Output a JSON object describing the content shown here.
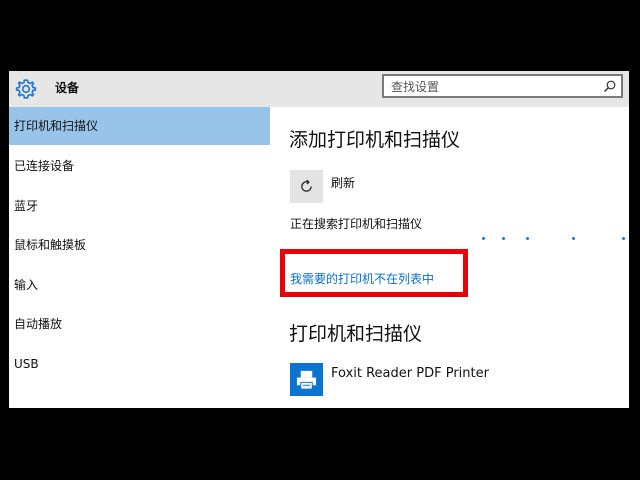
{
  "window": {
    "title": "设备"
  },
  "search": {
    "placeholder": "查找设置"
  },
  "sidebar": {
    "items": [
      {
        "label": "打印机和扫描仪",
        "active": true
      },
      {
        "label": "已连接设备"
      },
      {
        "label": "蓝牙"
      },
      {
        "label": "鼠标和触摸板"
      },
      {
        "label": "输入"
      },
      {
        "label": "自动播放"
      },
      {
        "label": "USB"
      }
    ]
  },
  "main": {
    "add_heading": "添加打印机和扫描仪",
    "refresh_label": "刷新",
    "searching_text": "正在搜索打印机和扫描仪",
    "not_listed_link": "我需要的打印机不在列表中",
    "printers_heading": "打印机和扫描仪",
    "printers": [
      {
        "name": "Foxit Reader PDF Printer"
      }
    ]
  },
  "colors": {
    "accent": "#0a6fc9",
    "active_item_bg": "#99c4e9",
    "highlight_border": "#e8000b",
    "printer_icon_bg": "#0a74d0"
  },
  "icons": {
    "settings": "gear-icon",
    "search": "search-icon",
    "refresh": "refresh-icon",
    "printer": "printer-icon"
  }
}
